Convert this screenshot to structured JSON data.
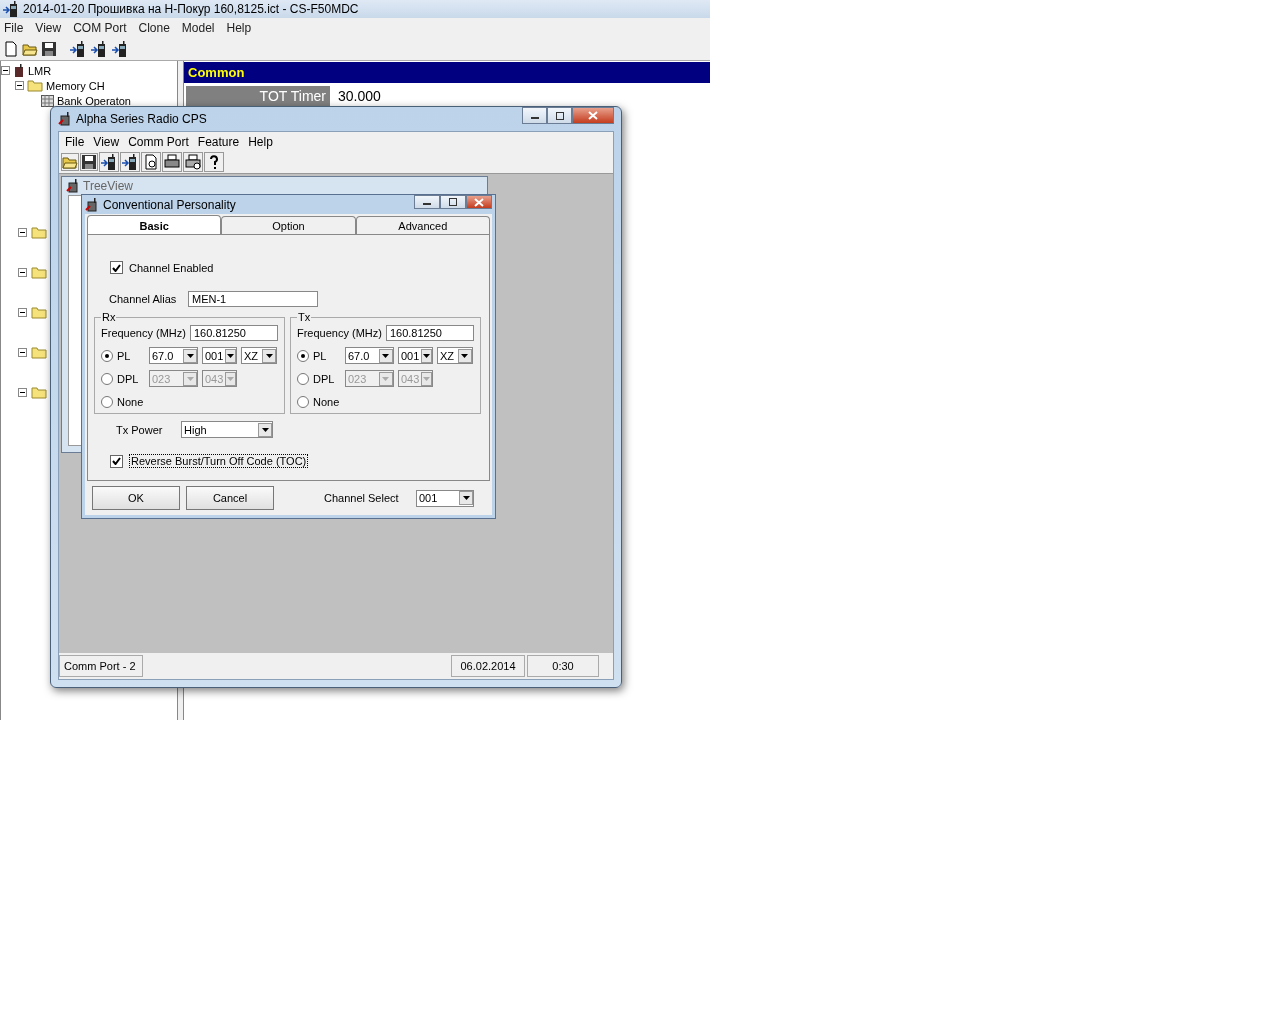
{
  "main_window": {
    "title": "2014-01-20 Прошивка на Н-Покур 160,8125.ict - CS-F50MDC",
    "menu": [
      "File",
      "View",
      "COM Port",
      "Clone",
      "Model",
      "Help"
    ],
    "tree": [
      {
        "label": "LMR",
        "expanded": true,
        "children": [
          {
            "label": "Memory CH",
            "expanded": true,
            "children": [
              {
                "label": "Bank Operaton"
              }
            ]
          }
        ]
      }
    ],
    "panel": {
      "title": "Common",
      "fields": [
        {
          "label": "TOT Timer",
          "value": "30.000"
        }
      ]
    }
  },
  "cps_window": {
    "title": "Alpha Series Radio CPS",
    "menu": [
      "File",
      "View",
      "Comm Port",
      "Feature",
      "Help"
    ],
    "treeview_title": "TreeView",
    "dialog": {
      "title": "Conventional Personality",
      "tabs": [
        {
          "label": "Basic",
          "selected": true
        },
        {
          "label": "Option",
          "selected": false
        },
        {
          "label": "Advanced",
          "selected": false
        }
      ],
      "channel_enabled": {
        "label": "Channel Enabled",
        "checked": true
      },
      "alias": {
        "label": "Channel Alias",
        "value": "MEN-1"
      },
      "groups": [
        {
          "title": "Rx",
          "frequency_label": "Frequency (MHz)",
          "frequency": "160.81250",
          "options": [
            {
              "label": "PL",
              "selected": true,
              "combos": [
                {
                  "value": "67.0",
                  "disabled": false
                },
                {
                  "value": "001",
                  "disabled": false
                },
                {
                  "value": "XZ",
                  "disabled": false
                }
              ]
            },
            {
              "label": "DPL",
              "selected": false,
              "combos": [
                {
                  "value": "023",
                  "disabled": true
                },
                {
                  "value": "043",
                  "disabled": true
                }
              ]
            },
            {
              "label": "None",
              "selected": false
            }
          ]
        },
        {
          "title": "Tx",
          "frequency_label": "Frequency (MHz)",
          "frequency": "160.81250",
          "options": [
            {
              "label": "PL",
              "selected": true,
              "combos": [
                {
                  "value": "67.0",
                  "disabled": false
                },
                {
                  "value": "001",
                  "disabled": false
                },
                {
                  "value": "XZ",
                  "disabled": false
                }
              ]
            },
            {
              "label": "DPL",
              "selected": false,
              "combos": [
                {
                  "value": "023",
                  "disabled": true
                },
                {
                  "value": "043",
                  "disabled": true
                }
              ]
            },
            {
              "label": "None",
              "selected": false
            }
          ]
        }
      ],
      "tx_power": {
        "label": "Tx Power",
        "value": "High"
      },
      "reverse_burst": {
        "label": "Reverse Burst/Turn Off Code (TOC)",
        "checked": true
      },
      "buttons": [
        "OK",
        "Cancel"
      ],
      "channel_select": {
        "label": "Channel Select",
        "value": "001"
      }
    },
    "status_bar": [
      "Comm Port - 2",
      "06.02.2014",
      "0:30"
    ]
  }
}
